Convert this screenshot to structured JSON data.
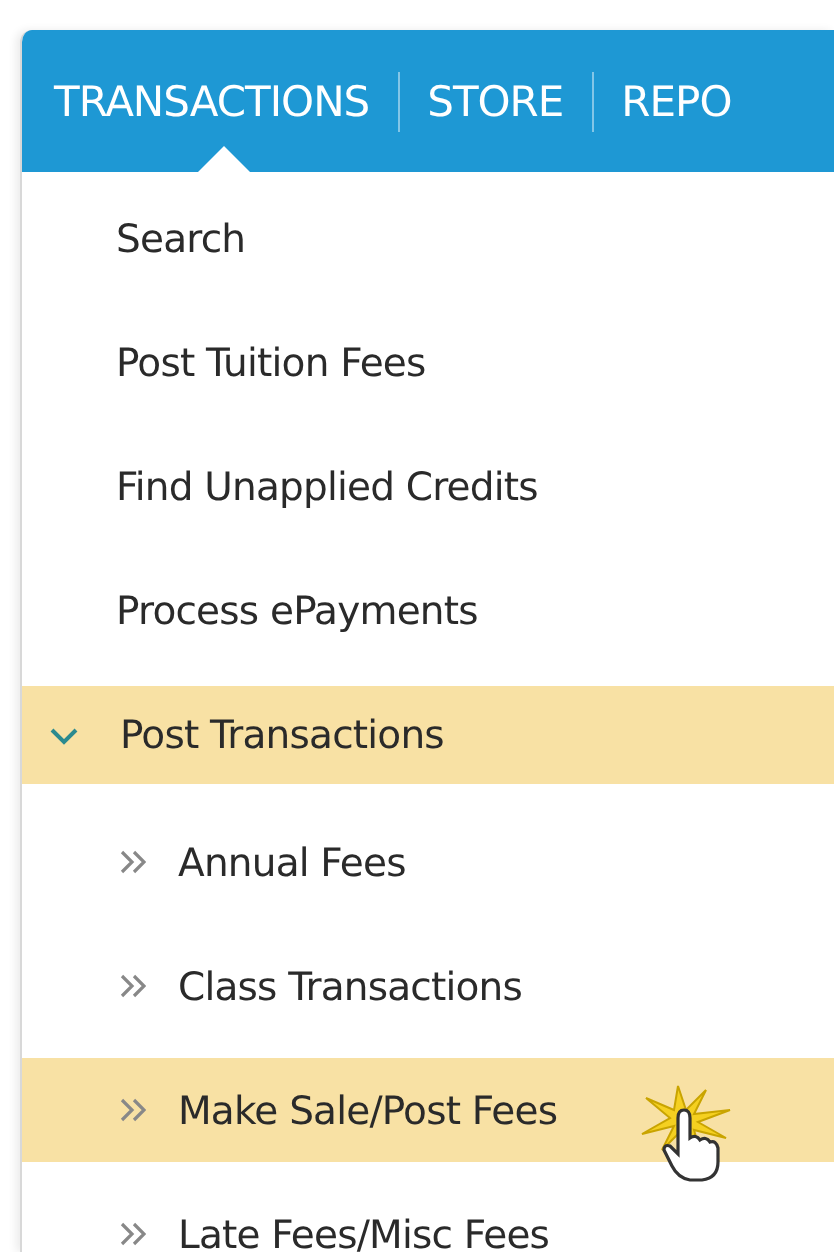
{
  "nav_tabs": [
    {
      "label": "TRANSACTIONS",
      "selected": true
    },
    {
      "label": "STORE",
      "selected": false
    },
    {
      "label": "REPO",
      "selected": false
    }
  ],
  "menu": [
    {
      "label": "Search",
      "kind": "link"
    },
    {
      "label": "Post Tuition Fees",
      "kind": "link"
    },
    {
      "label": "Find Unapplied Credits",
      "kind": "link"
    },
    {
      "label": "Process ePayments",
      "kind": "link"
    },
    {
      "label": "Post Transactions",
      "kind": "group",
      "expanded": true,
      "children": [
        {
          "label": "Annual Fees",
          "selected": false
        },
        {
          "label": "Class Transactions",
          "selected": false
        },
        {
          "label": "Make Sale/Post Fees",
          "selected": true
        },
        {
          "label": "Late Fees/Misc Fees",
          "selected": false
        }
      ]
    }
  ]
}
